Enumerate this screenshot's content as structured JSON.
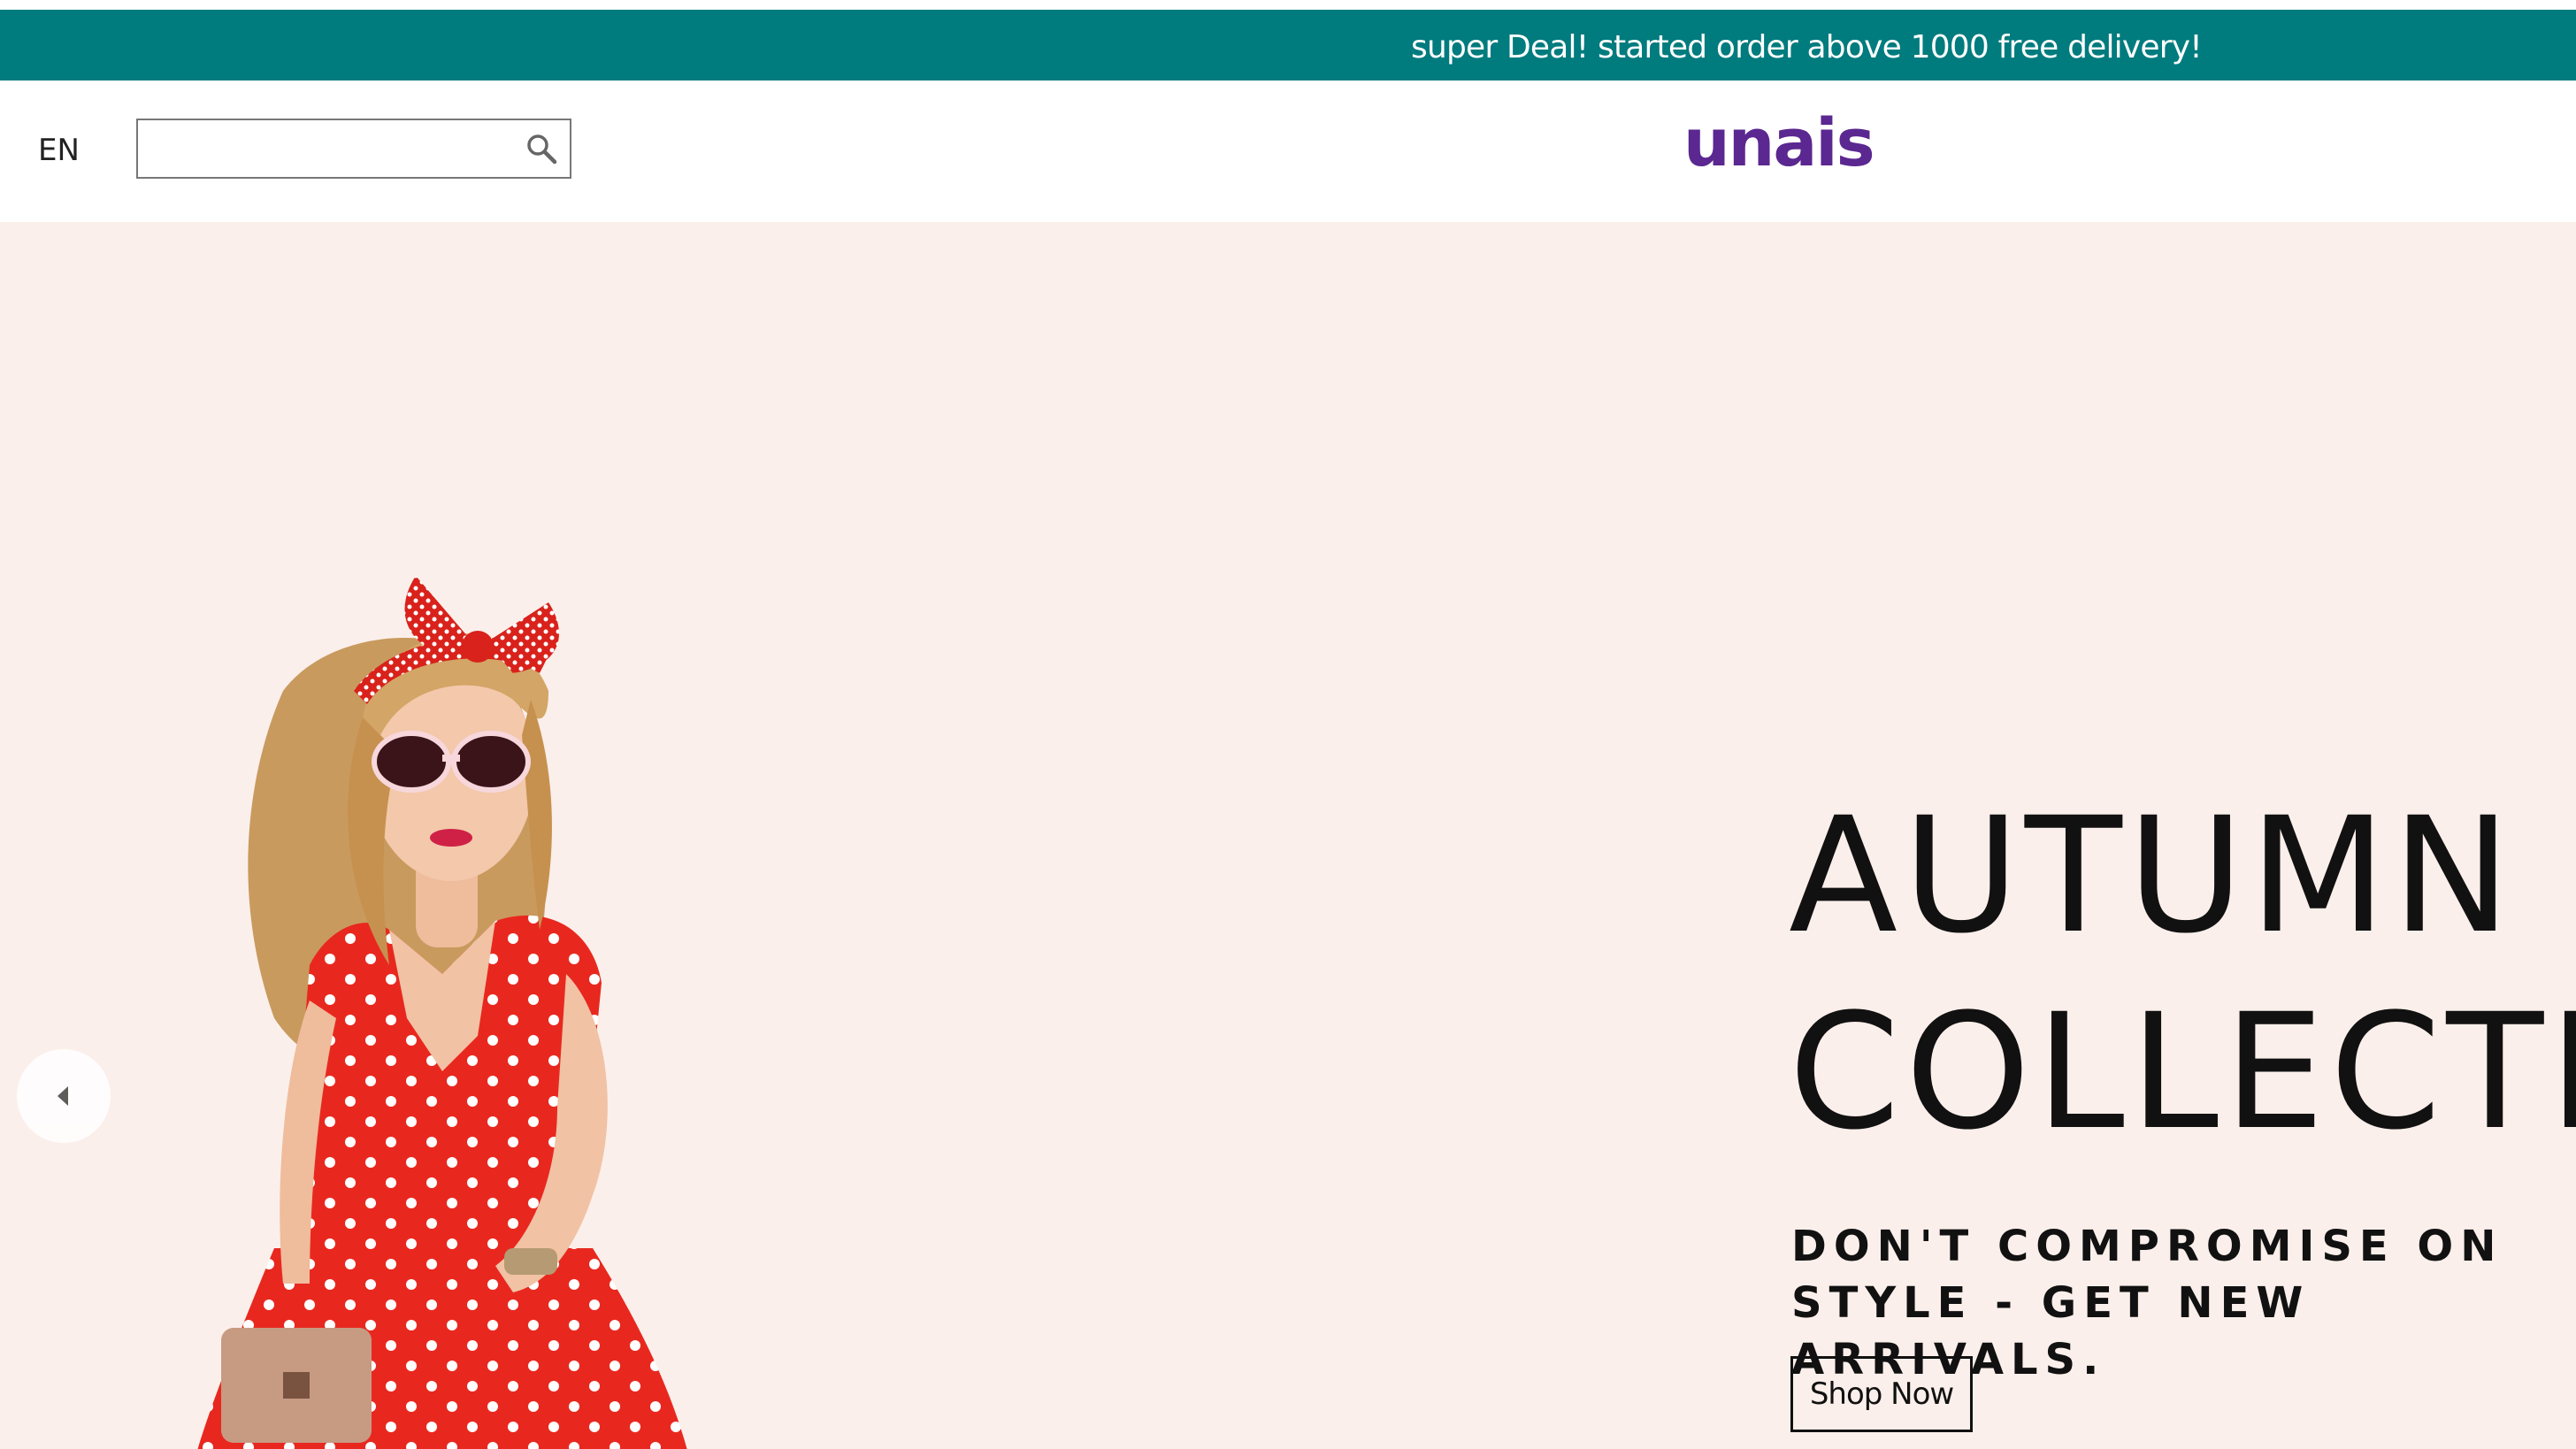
{
  "announcement": {
    "text": "super Deal! started order above 1000 free delivery!"
  },
  "header": {
    "language": "EN",
    "search": {
      "value": "",
      "placeholder": ""
    },
    "logo": "unais"
  },
  "hero": {
    "headline_line1": "AUTUMN",
    "headline_line2": "COLLECTION",
    "tagline": "DON'T COMPROMISE ON STYLE - GET NEW ARRIVALS.",
    "cta_label": "Shop Now",
    "image": "model-red-polka-dot-dress",
    "prev_icon": "chevron-left-icon"
  },
  "colors": {
    "topbar": "#007b7e",
    "logo": "#5b2790",
    "hero_background": "#fbefeb",
    "dress": "#e8281f"
  }
}
